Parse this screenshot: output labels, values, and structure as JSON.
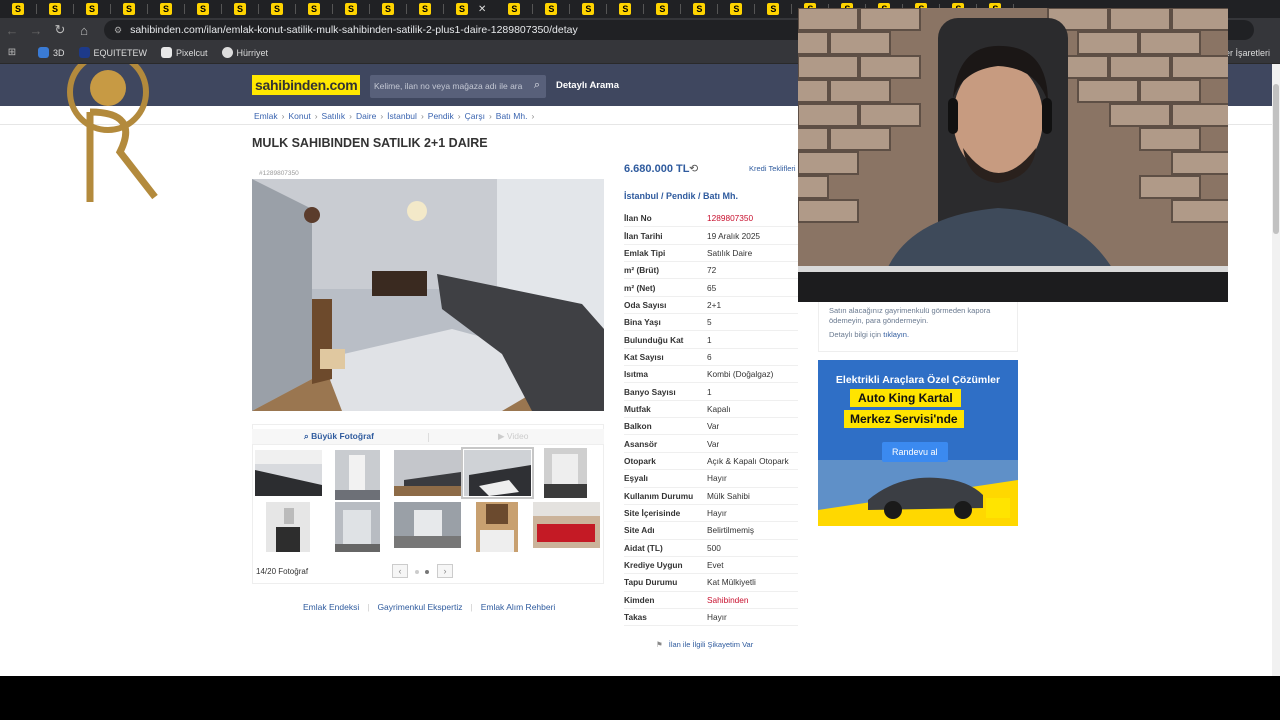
{
  "browser": {
    "tab_icon_label": "S",
    "url": "sahibinden.com/ilan/emlak-konut-satilik-mulk-sahibinden-satilik-2-plus1-daire-1289807350/detay",
    "bookmarks": [
      "3D",
      "EQUITETEW",
      "Pixelcut",
      "Hürriyet"
    ],
    "bookmarks_right": "Yer İşaretleri"
  },
  "header": {
    "logo": "sahibinden.com",
    "search_placeholder": "Kelime, ilan no veya mağaza adı ile ara",
    "detailed_search": "Detaylı Arama"
  },
  "breadcrumb": [
    "Emlak",
    "Konut",
    "Satılık",
    "Daire",
    "İstanbul",
    "Pendik",
    "Çarşı",
    "Batı Mh."
  ],
  "listing": {
    "title": "MULK SAHIBINDEN SATILIK 2+1 DAIRE",
    "id_small": "#1289807350",
    "price": "6.680.000 TL",
    "credit_link": "Kredi Teklifleri",
    "location": "İstanbul  /  Pendik  /  Batı Mh.",
    "details": [
      {
        "key": "İlan No",
        "value": "1289807350",
        "highlight": true
      },
      {
        "key": "İlan Tarihi",
        "value": "19 Aralık 2025"
      },
      {
        "key": "Emlak Tipi",
        "value": "Satılık Daire"
      },
      {
        "key": "m² (Brüt)",
        "value": "72"
      },
      {
        "key": "m² (Net)",
        "value": "65"
      },
      {
        "key": "Oda Sayısı",
        "value": "2+1"
      },
      {
        "key": "Bina Yaşı",
        "value": "5"
      },
      {
        "key": "Bulunduğu Kat",
        "value": "1"
      },
      {
        "key": "Kat Sayısı",
        "value": "6"
      },
      {
        "key": "Isıtma",
        "value": "Kombi (Doğalgaz)"
      },
      {
        "key": "Banyo Sayısı",
        "value": "1"
      },
      {
        "key": "Mutfak",
        "value": "Kapalı"
      },
      {
        "key": "Balkon",
        "value": "Var"
      },
      {
        "key": "Asansör",
        "value": "Var"
      },
      {
        "key": "Otopark",
        "value": "Açık & Kapalı Otopark"
      },
      {
        "key": "Eşyalı",
        "value": "Hayır"
      },
      {
        "key": "Kullanım Durumu",
        "value": "Mülk Sahibi"
      },
      {
        "key": "Site İçerisinde",
        "value": "Hayır"
      },
      {
        "key": "Site Adı",
        "value": "Belirtilmemiş"
      },
      {
        "key": "Aidat (TL)",
        "value": "500"
      },
      {
        "key": "Krediye Uygun",
        "value": "Evet"
      },
      {
        "key": "Tapu Durumu",
        "value": "Kat Mülkiyetli"
      },
      {
        "key": "Kimden",
        "value": "Sahibinden",
        "highlight": true
      },
      {
        "key": "Takas",
        "value": "Hayır"
      }
    ],
    "complaint": "İlan ile İlgili Şikayetim Var"
  },
  "gallery": {
    "big_photo": "Büyük Fotoğraf",
    "video": "Video",
    "count": "14/20 Fotoğraf",
    "prev": "‹",
    "next": "›"
  },
  "links": [
    "Emlak Endeksi",
    "Gayrimenkul Ekspertiz",
    "Emlak Alım Rehberi"
  ],
  "safety": {
    "text": "Satın alacağınız gayrimenkulü görmeden kapora ödemeyin, para göndermeyin.",
    "more_prefix": "Detaylı bilgi için",
    "more_link": "tıklayın."
  },
  "ad": {
    "title": "Elektrikli Araçlara Özel Çözümler",
    "brand": "Auto King Kartal",
    "service": "Merkez Servisi'nde",
    "cta": "Randevu al"
  },
  "colors": {
    "header_bg": "#3f475f",
    "logo_bg": "#ffe800",
    "link": "#2f5b9e",
    "highlight": "#c8102e"
  }
}
